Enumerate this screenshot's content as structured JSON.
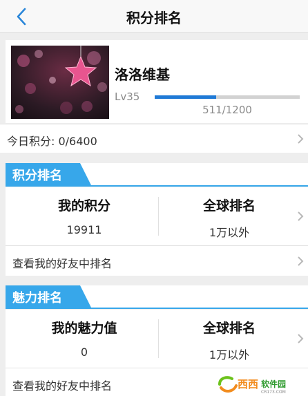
{
  "nav": {
    "title": "积分排名"
  },
  "profile": {
    "name": "洛洛维基",
    "level": "Lv35",
    "exp_text": "511/1200",
    "exp_progress": 0.426
  },
  "today": {
    "label": "今日积分: 0/6400"
  },
  "points_section": {
    "title": "积分排名",
    "my_label": "我的积分",
    "my_value": "19911",
    "global_label": "全球排名",
    "global_value": "1万以外",
    "friends_link": "查看我的好友中排名"
  },
  "charm_section": {
    "title": "魅力排名",
    "my_label": "我的魅力值",
    "my_value": "0",
    "global_label": "全球排名",
    "global_value": "1万以外",
    "friends_link": "查看我的好友中排名"
  },
  "watermark": {
    "text": "西西软件园",
    "subtext": "CR173.COM"
  },
  "colors": {
    "accent": "#37a7ea",
    "progress": "#1f7ad6",
    "back": "#2a86d9",
    "star": "#e8558f"
  },
  "icons": [
    "back-arrow-icon",
    "chevron-right-icon",
    "star-icon"
  ]
}
